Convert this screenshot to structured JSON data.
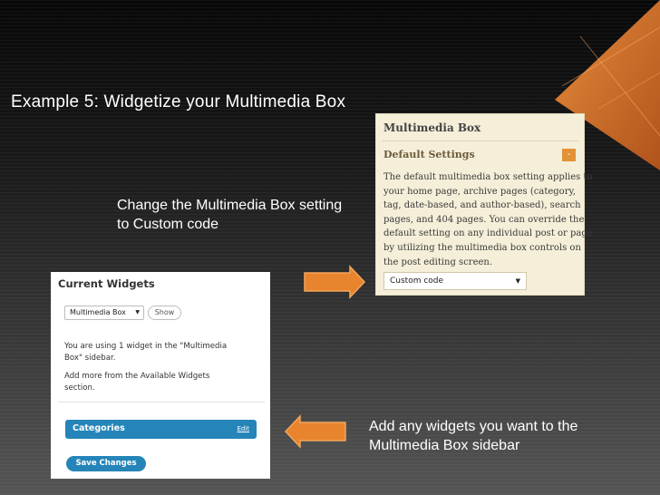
{
  "slide": {
    "title": "Example 5:  Widgetize your Multimedia Box",
    "caption_top": [
      "Change the Multimedia Box setting",
      "to Custom code"
    ],
    "caption_bottom": [
      "Add any widgets you want to the",
      "Multimedia Box sidebar"
    ]
  },
  "multimedia_box": {
    "heading": "Multimedia Box",
    "subheading": "Default Settings",
    "collapse_label": "-",
    "description": [
      "The default multimedia box setting applies to",
      "your home page, archive pages (category,",
      "tag, date-based, and author-based), search",
      "pages, and 404 pages. You can override the",
      "default setting on any individual post or page",
      "by utilizing the multimedia box controls on",
      "the post editing screen."
    ],
    "select_value": "Custom code"
  },
  "current_widgets": {
    "heading": "Current Widgets",
    "sidebar_select": "Multimedia Box",
    "show_label": "Show",
    "info": [
      "You are using 1 widget in the \"Multimedia",
      "Box\" sidebar."
    ],
    "add_more": [
      "Add more from the Available Widgets",
      "section."
    ],
    "widget_title": "Categories",
    "widget_edit": "Edit",
    "save_label": "Save Changes"
  },
  "colors": {
    "accent_orange": "#e8842e",
    "widget_blue": "#2585b8",
    "panel_cream": "#f5efd9"
  }
}
